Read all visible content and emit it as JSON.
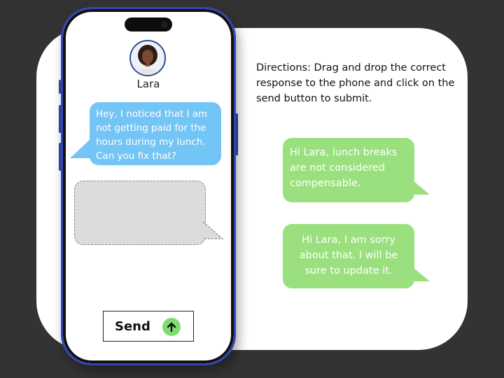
{
  "contact": {
    "name": "Lara"
  },
  "conversation": {
    "incoming_message": "Hey, I noticed that I am not getting paid for the hours during my lunch. Can you fix that?"
  },
  "send_button": {
    "label": "Send"
  },
  "directions": "Directions: Drag and drop the correct response to the phone and click on the send button to submit.",
  "options": [
    {
      "text": "Hi Lara, lunch breaks are not considered compensable."
    },
    {
      "text": "Hi Lara, I am sorry about that. I will be sure to update it."
    }
  ],
  "colors": {
    "background": "#333333",
    "incoming_bubble": "#73c5f5",
    "option_bubble": "#9be07f",
    "phone_frame": "#3346b0",
    "send_icon": "#7fdc75"
  }
}
